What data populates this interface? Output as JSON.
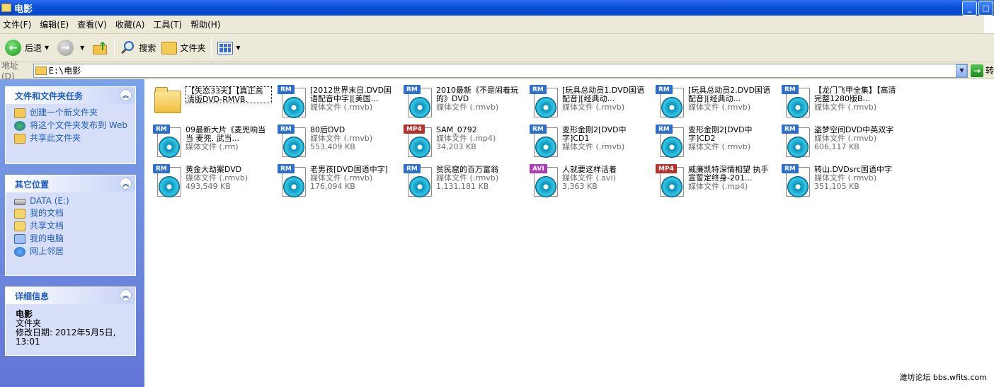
{
  "window": {
    "title": "电影",
    "minimize": "_",
    "maximize": "□"
  },
  "menu": [
    "文件(F)",
    "编辑(E)",
    "查看(V)",
    "收藏(A)",
    "工具(T)",
    "帮助(H)"
  ],
  "toolbar": {
    "back_label": "后退",
    "search_label": "搜索",
    "folders_label": "文件夹"
  },
  "address": {
    "label": "地址(D)",
    "value": "E:\\电影",
    "go_label": "转"
  },
  "sidebar": {
    "tasks": {
      "title": "文件和文件夹任务",
      "items": [
        "创建一个新文件夹",
        "将这个文件夹发布到 Web",
        "共享此文件夹"
      ]
    },
    "places": {
      "title": "其它位置",
      "items": [
        "DATA (E:)",
        "我的文档",
        "共享文档",
        "我的电脑",
        "网上邻居"
      ]
    },
    "details": {
      "title": "详细信息",
      "name": "电影",
      "type": "文件夹",
      "modified": "修改日期: 2012年5月5日, 13:01"
    }
  },
  "files": [
    {
      "name": "【失恋33天】【真正高清版DVD-RMVB.",
      "meta": "",
      "size": "",
      "badge": "",
      "kind": "folder"
    },
    {
      "name": "[2012世界末日.DVD国语配音中字][美国...",
      "meta": "媒体文件 (.rmvb)",
      "size": "",
      "badge": "RM",
      "kind": "rm"
    },
    {
      "name": "2010最新《不是闹着玩的》DVD",
      "meta": "媒体文件 (.rmvb)",
      "size": "",
      "badge": "RM",
      "kind": "rm"
    },
    {
      "name": "[玩具总动员1.DVD国语配音][经典动...",
      "meta": "媒体文件 (.rmvb)",
      "size": "",
      "badge": "RM",
      "kind": "rm"
    },
    {
      "name": "[玩具总动员2.DVD国语配音][经典动...",
      "meta": "媒体文件 (.rmvb)",
      "size": "",
      "badge": "RM",
      "kind": "rm"
    },
    {
      "name": "【龙门飞甲全集】【高清完整1280版B...",
      "meta": "媒体文件 (.rmvb)",
      "size": "",
      "badge": "RM",
      "kind": "rm"
    },
    {
      "name": "09最新大片《麦兜响当当 麦兜. 武当...",
      "meta": "媒体文件 (.rm)",
      "size": "",
      "badge": "RM",
      "kind": "rm"
    },
    {
      "name": "80后DVD",
      "meta": "媒体文件 (.rmvb)",
      "size": "553,409 KB",
      "badge": "RM",
      "kind": "rm"
    },
    {
      "name": "SAM_0792",
      "meta": "媒体文件 (.mp4)",
      "size": "34,203 KB",
      "badge": "MP4",
      "kind": "mp4"
    },
    {
      "name": "变形金刚2[DVD中字]CD1",
      "meta": "媒体文件 (.rmvb)",
      "size": "",
      "badge": "RM",
      "kind": "rm"
    },
    {
      "name": "变形金刚2[DVD中字]CD2",
      "meta": "媒体文件 (.rmvb)",
      "size": "",
      "badge": "RM",
      "kind": "rm"
    },
    {
      "name": "盗梦空间DVD中英双字",
      "meta": "媒体文件 (.rmvb)",
      "size": "606,117 KB",
      "badge": "RM",
      "kind": "rm"
    },
    {
      "name": "黄金大劫案DVD",
      "meta": "媒体文件 (.rmvb)",
      "size": "493,549 KB",
      "badge": "RM",
      "kind": "rm"
    },
    {
      "name": "老男孩[DVD国语中字]",
      "meta": "媒体文件 (.rmvb)",
      "size": "176,094 KB",
      "badge": "RM",
      "kind": "rm"
    },
    {
      "name": "贫民窟的百万富翁",
      "meta": "媒体文件 (.rmvb)",
      "size": "1,131,181 KB",
      "badge": "RM",
      "kind": "rm"
    },
    {
      "name": "人就要这样活着",
      "meta": "媒体文件 (.avi)",
      "size": "3,363 KB",
      "badge": "AVI",
      "kind": "avi"
    },
    {
      "name": "威廉凯特深情相望 执手宣誓定终身-201...",
      "meta": "媒体文件 (.mp4)",
      "size": "",
      "badge": "MP4",
      "kind": "mp4"
    },
    {
      "name": "转山.DVDsrc国语中字",
      "meta": "媒体文件 (.rmvb)",
      "size": "351,105 KB",
      "badge": "RM",
      "kind": "rm"
    }
  ],
  "watermark": "潍坊论坛 bbs.wfits.com"
}
